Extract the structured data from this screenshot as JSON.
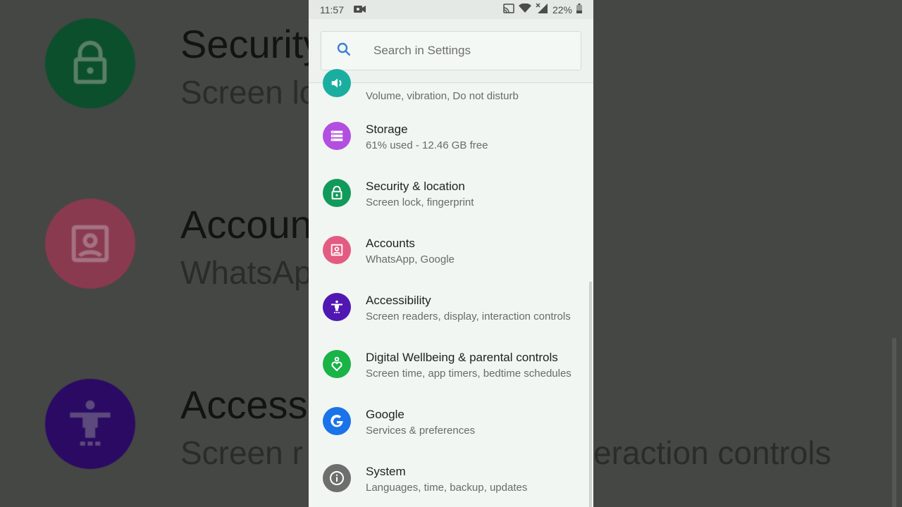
{
  "status": {
    "time": "11:57",
    "battery": "22%"
  },
  "search": {
    "placeholder": "Search in Settings"
  },
  "items": [
    {
      "title": "",
      "subtitle": "Volume, vibration, Do not disturb",
      "color": "#1aaea0",
      "icon": "sound-icon"
    },
    {
      "title": "Storage",
      "subtitle": "61% used - 12.46 GB free",
      "color": "#b24ee0",
      "icon": "storage-icon"
    },
    {
      "title": "Security & location",
      "subtitle": "Screen lock, fingerprint",
      "color": "#129a5a",
      "icon": "lock-icon"
    },
    {
      "title": "Accounts",
      "subtitle": "WhatsApp, Google",
      "color": "#e45b82",
      "icon": "account-icon"
    },
    {
      "title": "Accessibility",
      "subtitle": "Screen readers, display, interaction controls",
      "color": "#5017b3",
      "icon": "accessibility-icon"
    },
    {
      "title": "Digital Wellbeing & parental controls",
      "subtitle": "Screen time, app timers, bedtime schedules",
      "color": "#19b347",
      "icon": "wellbeing-icon"
    },
    {
      "title": "Google",
      "subtitle": "Services & preferences",
      "color": "#1a73e8",
      "icon": "google-icon"
    },
    {
      "title": "System",
      "subtitle": "Languages, time, backup, updates",
      "color": "#6c6f6d",
      "icon": "info-icon"
    }
  ],
  "background": {
    "rows": [
      {
        "title": "Security",
        "subtitle": "Screen lo"
      },
      {
        "title": "Accoun",
        "subtitle": "WhatsAp"
      },
      {
        "title": "Access",
        "subtitle": "Screen r"
      }
    ],
    "right_text": "eraction controls"
  }
}
